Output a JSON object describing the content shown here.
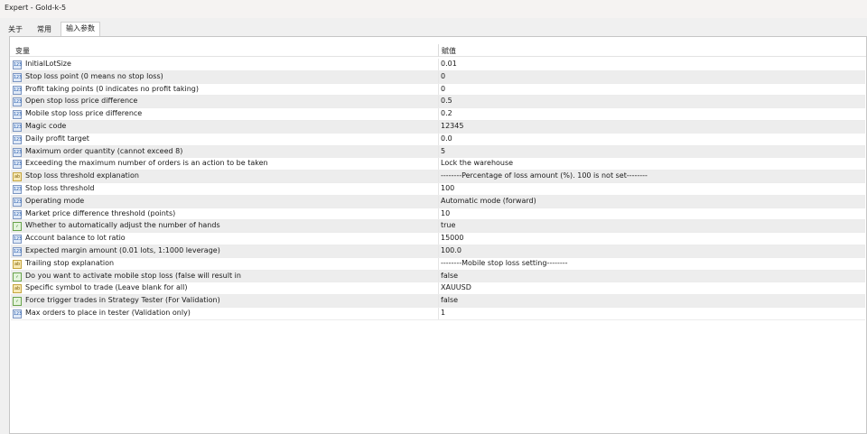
{
  "window": {
    "title": "Expert - Gold-k-5"
  },
  "tabs": [
    {
      "label": "关于",
      "active": false
    },
    {
      "label": "常用",
      "active": false
    },
    {
      "label": "输入参数",
      "active": true
    }
  ],
  "table": {
    "headers": {
      "variable": "变量",
      "value": "赋值"
    },
    "rows": [
      {
        "icon": "123",
        "name": "InitialLotSize",
        "value": "0.01"
      },
      {
        "icon": "123",
        "name": "Stop loss point (0 means no stop loss)",
        "value": "0"
      },
      {
        "icon": "123",
        "name": "Profit taking points (0 indicates no profit taking)",
        "value": "0"
      },
      {
        "icon": "123",
        "name": "Open stop loss price difference",
        "value": "0.5"
      },
      {
        "icon": "123",
        "name": "Mobile stop loss price difference",
        "value": "0.2"
      },
      {
        "icon": "123",
        "name": "Magic code",
        "value": "12345"
      },
      {
        "icon": "123",
        "name": "Daily profit target",
        "value": "0.0"
      },
      {
        "icon": "123",
        "name": "Maximum order quantity (cannot exceed 8)",
        "value": "5"
      },
      {
        "icon": "123",
        "name": "Exceeding the maximum number of orders is an action to be taken",
        "value": "Lock the warehouse"
      },
      {
        "icon": "ab",
        "name": "Stop loss threshold explanation",
        "value": "--------Percentage of loss amount (%). 100 is not set--------"
      },
      {
        "icon": "123",
        "name": "Stop loss threshold",
        "value": "100"
      },
      {
        "icon": "123",
        "name": "Operating mode",
        "value": "Automatic mode (forward)"
      },
      {
        "icon": "123",
        "name": "Market price difference threshold (points)",
        "value": "10"
      },
      {
        "icon": "bool",
        "name": "Whether to automatically adjust the number of hands",
        "value": "true"
      },
      {
        "icon": "123",
        "name": "Account balance to lot ratio",
        "value": "15000"
      },
      {
        "icon": "123",
        "name": "Expected margin amount (0.01 lots, 1:1000 leverage)",
        "value": "100.0"
      },
      {
        "icon": "ab",
        "name": "Trailing stop explanation",
        "value": "--------Mobile stop loss setting--------"
      },
      {
        "icon": "bool",
        "name": "Do you want to activate mobile stop loss (false will result in",
        "value": "false"
      },
      {
        "icon": "ab",
        "name": "Specific symbol to trade (Leave blank for all)",
        "value": "XAUUSD"
      },
      {
        "icon": "bool",
        "name": "Force trigger trades in Strategy Tester (For Validation)",
        "value": "false"
      },
      {
        "icon": "123",
        "name": "Max orders to place in tester (Validation only)",
        "value": "1"
      }
    ]
  }
}
